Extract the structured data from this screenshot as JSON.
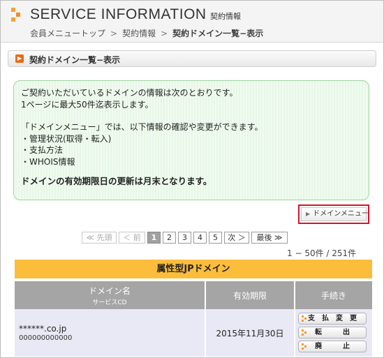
{
  "header": {
    "title": "SERVICE INFORMATION",
    "subtitle": "契約情報",
    "breadcrumb": [
      "会員メニュートップ",
      "契約情報",
      "契約ドメイン一覧−表示"
    ],
    "breadcrumb_separator": ">"
  },
  "page_heading": {
    "bullet": "▶",
    "title": "契約ドメイン一覧−表示"
  },
  "info_box": {
    "lines": [
      "ご契約いただいているドメインの情報は次のとおりです。",
      "1ページに最大50件迄表示します。",
      "「ドメインメニュー」では、以下情報の確認や変更ができます。",
      "・管理状況(取得・転入)",
      "・支払方法",
      "・WHOIS情報"
    ],
    "notice": "ドメインの有効期限日の更新は月末となります。"
  },
  "domain_menu_button": {
    "arrow": "▶",
    "label": "ドメインメニュー"
  },
  "pager": {
    "first": "≪ 先頭",
    "prev": "＜ 前",
    "pages": [
      "1",
      "2",
      "3",
      "4",
      "5"
    ],
    "current": "1",
    "next": "次 ＞",
    "last": "最後 ≫",
    "count": "1 − 50件 / 251件"
  },
  "table": {
    "caption": "属性型JPドメイン",
    "headers": {
      "domain": "ドメイン名",
      "service_cd": "サービスCD",
      "expiry": "有効期限",
      "actions": "手続き"
    },
    "rows": [
      {
        "domain": "******.co.jp",
        "service_cd": "000000000000",
        "expiry": "2015年11月30日"
      }
    ],
    "action_labels": [
      "支　払　変　更",
      "転　　　出",
      "廃　　　止"
    ]
  },
  "colors": {
    "accent_orange": "#fbbd3b",
    "highlight_red": "#d8102c",
    "info_green": "#9fd3a0",
    "header_gray": "#a5a5a5"
  }
}
